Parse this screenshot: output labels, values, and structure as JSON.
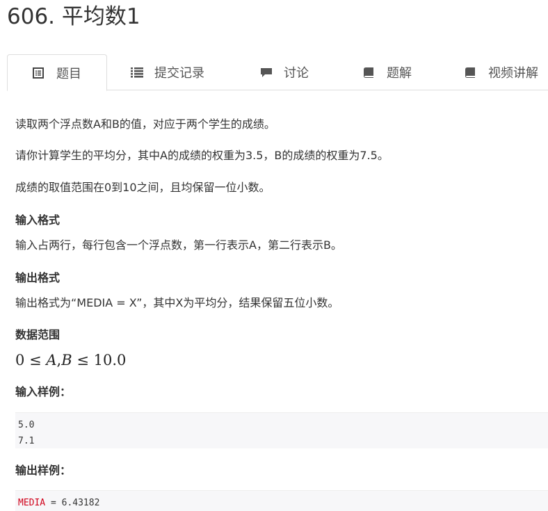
{
  "problem": {
    "title": "606. 平均数1"
  },
  "tabs": [
    {
      "label": "题目",
      "icon": "list-alt-icon",
      "active": true
    },
    {
      "label": "提交记录",
      "icon": "list-icon",
      "active": false
    },
    {
      "label": "讨论",
      "icon": "comment-icon",
      "active": false
    },
    {
      "label": "题解",
      "icon": "book-icon",
      "active": false
    },
    {
      "label": "视频讲解",
      "icon": "book-icon",
      "active": false
    }
  ],
  "description": {
    "p1": "读取两个浮点数A和B的值，对应于两个学生的成绩。",
    "p2": "请你计算学生的平均分，其中A的成绩的权重为3.5，B的成绩的权重为7.5。",
    "p3": "成绩的取值范围在0到10之间，且均保留一位小数。"
  },
  "input_format": {
    "heading": "输入格式",
    "text": "输入占两行，每行包含一个浮点数，第一行表示A，第二行表示B。"
  },
  "output_format": {
    "heading": "输出格式",
    "text": "输出格式为“MEDIA = X”，其中X为平均分，结果保留五位小数。"
  },
  "data_range": {
    "heading": "数据范围",
    "formula": {
      "lhs": "0",
      "le1": "≤",
      "var_a": "A",
      "comma": ",",
      "var_b": "B",
      "le2": "≤",
      "rhs": "10.0"
    }
  },
  "sample_input": {
    "heading": "输入样例：",
    "lines": [
      "5.0",
      "7.1"
    ]
  },
  "sample_output": {
    "heading": "输出样例：",
    "keyword": "MEDIA",
    "rest": " = 6.43182"
  },
  "colors": {
    "accent_red": "#c7254e",
    "tab_border": "#dddddd",
    "code_bg": "#f7f7f9"
  }
}
